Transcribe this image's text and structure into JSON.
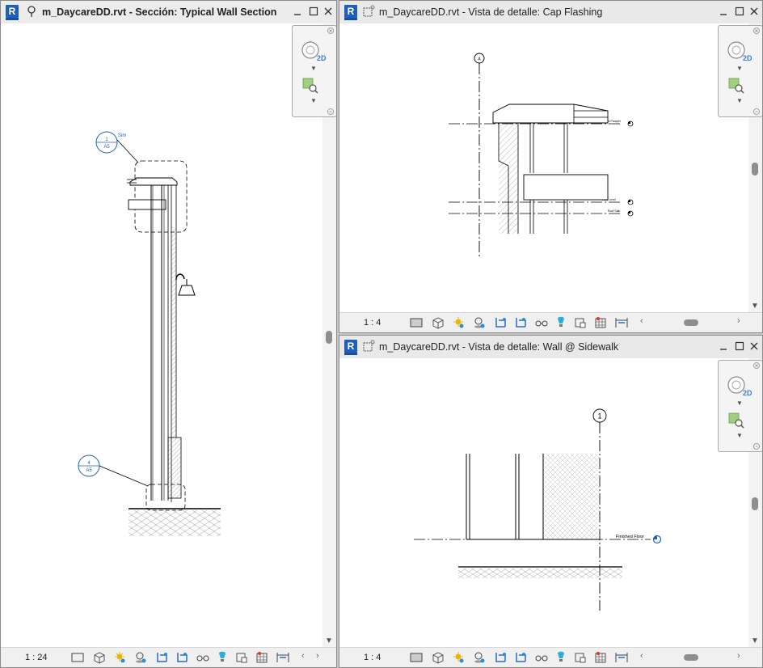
{
  "windows": [
    {
      "id": "section",
      "title": "m_DaycareDD.rvt - Sección: Typical Wall Section",
      "active": true,
      "scale": "1 : 24",
      "labels": {
        "sim": "Sim",
        "callout1_num": "1",
        "callout1_sheet": "A5",
        "callout2_num": "4",
        "callout2_sheet": "A5"
      }
    },
    {
      "id": "cap",
      "title": "m_DaycareDD.rvt - Vista de detalle: Cap Flashing",
      "active": false,
      "scale": "1 : 4",
      "labels": {
        "grid": "A",
        "level1": "Top of Parapet",
        "level2": "Roof Level",
        "level3": "Roof Slab"
      }
    },
    {
      "id": "sidewalk",
      "title": "m_DaycareDD.rvt - Vista de detalle: Wall @ Sidewalk",
      "active": false,
      "scale": "1 : 4",
      "labels": {
        "grid": "1",
        "level": "Finished Floor"
      }
    }
  ],
  "nav_bar": {
    "mode_2d": "2D"
  },
  "status_icons": [
    "detail-level-icon",
    "visual-style-icon",
    "sun-path-icon",
    "shadows-icon",
    "crop-view-icon",
    "show-crop-icon",
    "temporary-hide-icon",
    "reveal-hidden-icon",
    "lock-3d-icon",
    "analytical-model-icon",
    "highlight-displacement-icon"
  ],
  "colors": {
    "accent": "#1f5fb8",
    "callout": "#1f5fb8"
  }
}
